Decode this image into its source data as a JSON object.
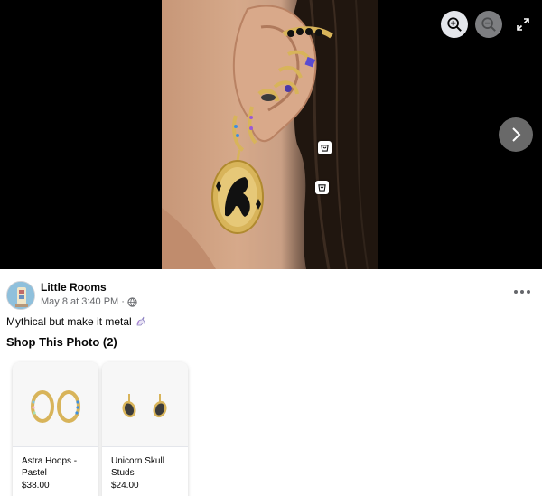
{
  "viewer": {
    "zoom_in_icon": "zoom-in-icon",
    "zoom_out_icon": "zoom-out-icon",
    "fullscreen_icon": "fullscreen-icon",
    "next_icon": "chevron-right-icon",
    "tag_icon": "shopping-bag-icon",
    "bg_color": "#000000"
  },
  "post": {
    "page_name": "Little Rooms",
    "timestamp": "May 8 at 3:40 PM",
    "separator": "·",
    "privacy_icon": "globe-icon",
    "more_icon": "more-horizontal-icon",
    "caption": "Mythical but make it metal",
    "caption_emoji": "unicorn-emoji"
  },
  "shop": {
    "title": "Shop This Photo (2)",
    "products": [
      {
        "name": "Astra Hoops - Pastel",
        "price": "$38.00"
      },
      {
        "name": "Unicorn Skull Studs",
        "price": "$24.00"
      }
    ]
  },
  "colors": {
    "text_primary": "#050505",
    "text_secondary": "#65676b",
    "gold": "#d8b45a"
  }
}
